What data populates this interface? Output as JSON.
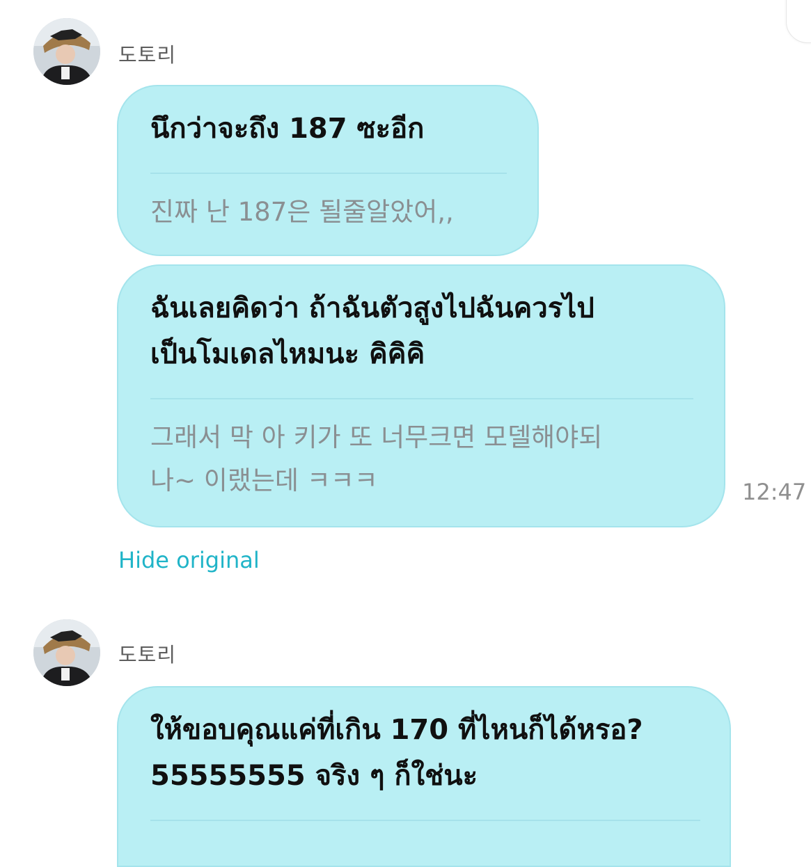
{
  "messages": [
    {
      "sender": "도토리",
      "bubbles": [
        {
          "translation": [
            "นึกว่าจะถึง 187 ซะอีก"
          ],
          "original": [
            "진짜 난 187은 될줄알았어,,"
          ]
        },
        {
          "translation": [
            "ฉันเลยคิดว่า ถ้าฉันตัวสูงไปฉันควรไป",
            "เป็นโมเดลไหมนะ คิคิคิ"
          ],
          "original": [
            "그래서 막 아 키가 또 너무크면 모델해야되",
            "나~ 이랬는데 ㅋㅋㅋ"
          ]
        }
      ],
      "time": "12:47",
      "toggle_label": "Hide original"
    },
    {
      "sender": "도토리",
      "bubbles": [
        {
          "translation": [
            "ให้ขอบคุณแค่ที่เกิน 170 ที่ไหนก็ได้หรอ?",
            "55555555 จริง ๆ ก็ใช่นะ"
          ]
        }
      ]
    }
  ],
  "colors": {
    "bubble_bg": "#b9eff4",
    "bubble_border": "#a4e4ec",
    "link": "#20b4c8",
    "original_text": "#8a8f92"
  }
}
